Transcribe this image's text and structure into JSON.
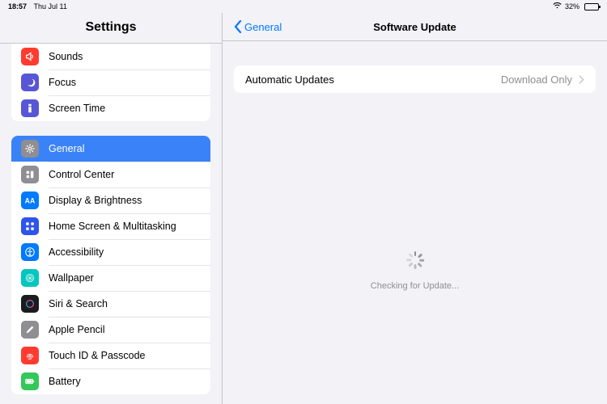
{
  "status": {
    "time": "18:57",
    "date": "Thu Jul 11",
    "battery_pct": "32%",
    "battery_fill": 32
  },
  "sidebar": {
    "title": "Settings",
    "group1": [
      {
        "label": "Sounds",
        "icon": "sounds-icon",
        "bg": "#ff3b30"
      },
      {
        "label": "Focus",
        "icon": "focus-icon",
        "bg": "#5856d6"
      },
      {
        "label": "Screen Time",
        "icon": "screentime-icon",
        "bg": "#5856d6"
      }
    ],
    "group2": [
      {
        "label": "General",
        "icon": "general-icon",
        "bg": "#8e8e93",
        "selected": true
      },
      {
        "label": "Control Center",
        "icon": "controlcenter-icon",
        "bg": "#8e8e93"
      },
      {
        "label": "Display & Brightness",
        "icon": "display-icon",
        "bg": "#007aff"
      },
      {
        "label": "Home Screen & Multitasking",
        "icon": "homescreen-icon",
        "bg": "#2f54eb"
      },
      {
        "label": "Accessibility",
        "icon": "accessibility-icon",
        "bg": "#007aff"
      },
      {
        "label": "Wallpaper",
        "icon": "wallpaper-icon",
        "bg": "#00c7be"
      },
      {
        "label": "Siri & Search",
        "icon": "siri-icon",
        "bg": "#1c1c1e"
      },
      {
        "label": "Apple Pencil",
        "icon": "pencil-icon",
        "bg": "#8e8e93"
      },
      {
        "label": "Touch ID & Passcode",
        "icon": "touchid-icon",
        "bg": "#ff3b30"
      },
      {
        "label": "Battery",
        "icon": "battery-icon",
        "bg": "#34c759"
      }
    ]
  },
  "detail": {
    "back": "General",
    "title": "Software Update",
    "row": {
      "label": "Automatic Updates",
      "value": "Download Only"
    },
    "status_text": "Checking for Update..."
  }
}
